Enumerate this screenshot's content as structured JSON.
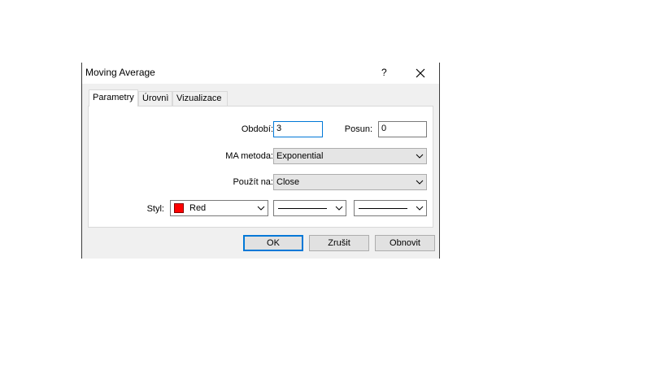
{
  "window": {
    "title": "Moving Average",
    "help_label": "?"
  },
  "tabs": [
    {
      "label": "Parametry",
      "active": true
    },
    {
      "label": "Úrovnì",
      "active": false
    },
    {
      "label": "Vizualizace",
      "active": false
    }
  ],
  "params": {
    "period_label": "Období:",
    "period_value": "3",
    "shift_label": "Posun:",
    "shift_value": "0",
    "method_label": "MA metoda:",
    "method_value": "Exponential",
    "apply_label": "Použít na:",
    "apply_value": "Close",
    "style_label": "Styl:",
    "color_value": "Red",
    "color_hex": "#ff0000"
  },
  "buttons": {
    "ok": "OK",
    "cancel": "Zrušit",
    "reset": "Obnovit"
  },
  "colors": {
    "accent": "#0078d7"
  }
}
